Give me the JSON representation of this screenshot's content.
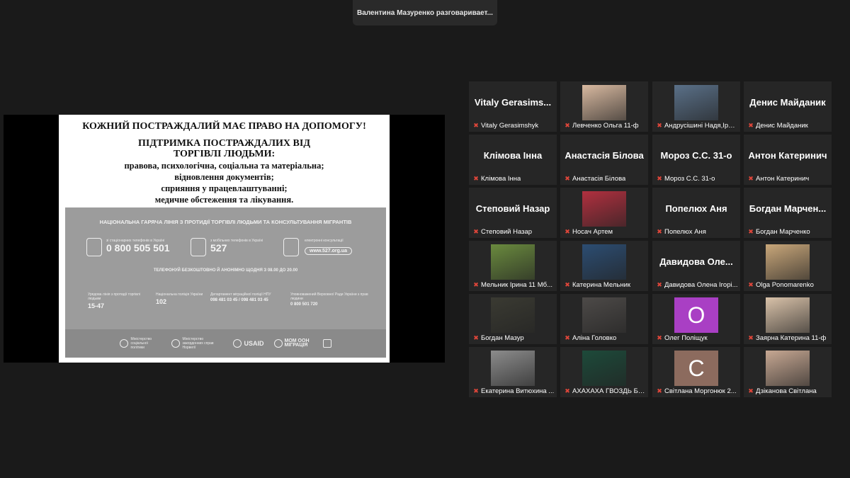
{
  "speaker_toast": "Валентина Мазуренко разговаривает...",
  "slide": {
    "heading_lines": [
      "КОЖНИЙ ПОСТРАЖДАЛИЙ МАЄ ПРАВО НА ДОПОМОГУ!",
      "ПІДТРИМКА ПОСТРАЖДАЛИХ ВІД",
      "ТОРГІВЛІ ЛЮДЬМИ:"
    ],
    "lines": [
      "правова, психологічна, соціальна та матеріальна;",
      "відновлення документів;",
      "сприяння у працевлаштуванні;",
      "медичне обстеження та лікування."
    ],
    "poster": {
      "title": "НАЦІОНАЛЬНА ГАРЯЧА ЛІНІЯ З ПРОТИДІЇ ТОРГІВЛІ ЛЮДЬМИ ТА КОНСУЛЬТУВАННЯ МІГРАНТІВ",
      "landline_caption": "зі стаціонарних телефонів в Україні",
      "landline_number": "0 800 505 501",
      "mobile_caption": "з мобільних телефонів в Україні",
      "mobile_number": "527",
      "online_caption": "електронні консультації",
      "online_url": "www.527.org.ua",
      "free_note": "ТЕЛЕФОНУЙ БЕЗКОШТОВНО Й АНОНІМНО ЩОДНЯ З 08.00 ДО 20.00",
      "contacts": [
        {
          "caption": "Урядова лінія з протидії торгівлі людьми",
          "number": "15-47"
        },
        {
          "caption": "Національна поліція України",
          "number": "102"
        },
        {
          "caption": "Департамент міграційної поліції НПУ",
          "number": "098 481 03 45  /  098 481 03 45"
        },
        {
          "caption": "Уповноважений Верховної Ради України з прав людини",
          "number": "0 800 501 720"
        }
      ],
      "logos": [
        {
          "name": "Міністерство соціальної політики"
        },
        {
          "name": "Міністерство закордонних справ Норвегії"
        },
        {
          "name": "USAID"
        },
        {
          "name": "МОМ ООН МІГРАЦІЯ"
        }
      ]
    }
  },
  "participants": [
    {
      "tile_name": "Vitaly Gerasims...",
      "label": "Vitaly Gerasimshyk",
      "photo": false
    },
    {
      "tile_name": "",
      "label": "Левченко Ольга 11-ф",
      "photo": true,
      "photo_color": "#d8b9a0"
    },
    {
      "tile_name": "",
      "label": "Андрусішині Надя,Іра,...",
      "photo": true,
      "photo_color": "#5a7088"
    },
    {
      "tile_name": "Денис Майданик",
      "label": "Денис Майданик",
      "photo": false
    },
    {
      "tile_name": "Клімова Інна",
      "label": "Клімова Інна",
      "photo": false
    },
    {
      "tile_name": "Анастасія Білова",
      "label": "Анастасія Білова",
      "photo": false
    },
    {
      "tile_name": "Мороз С.С. 31-о",
      "label": "Мороз С.С. 31-о",
      "photo": false
    },
    {
      "tile_name": "Антон Катеринич",
      "label": "Антон Катеринич",
      "photo": false
    },
    {
      "tile_name": "Степовий Назар",
      "label": "Степовий Назар",
      "photo": false
    },
    {
      "tile_name": "",
      "label": "Носач Артем",
      "photo": true,
      "photo_color": "#b1303f"
    },
    {
      "tile_name": "Попелюх Аня",
      "label": "Попелюх Аня",
      "photo": false
    },
    {
      "tile_name": "Богдан Марчен...",
      "label": "Богдан Марченко",
      "photo": false
    },
    {
      "tile_name": "",
      "label": "Мельник Ірина 11 Мб...",
      "photo": true,
      "photo_color": "#6a8a3e"
    },
    {
      "tile_name": "",
      "label": "Катерина Мельник",
      "photo": true,
      "photo_color": "#2c4d72"
    },
    {
      "tile_name": "Давидова Оле...",
      "label": "Давидова Олена Ігорі...",
      "photo": false
    },
    {
      "tile_name": "",
      "label": "Olga Ponomarenko",
      "photo": true,
      "photo_color": "#c9a77a"
    },
    {
      "tile_name": "",
      "label": "Богдан Мазур",
      "photo": true,
      "photo_color": "#3a3a32"
    },
    {
      "tile_name": "",
      "label": "Аліна Головко",
      "photo": true,
      "photo_color": "#4d4a48"
    },
    {
      "tile_name": "",
      "label": "Олег Поліщук",
      "photo": false,
      "avatar_letter": "O",
      "avatar_color": "#a93fc4"
    },
    {
      "tile_name": "",
      "label": "Заярна Катерина 11-ф",
      "photo": true,
      "photo_color": "#d9c2a9"
    },
    {
      "tile_name": "",
      "label": "Екатерина Витюхина ...",
      "photo": true,
      "photo_color": "#8c8c8c"
    },
    {
      "tile_name": "",
      "label": "АХАХАХА ГВОЗДЬ БЕГ...",
      "photo": true,
      "photo_color": "#1d4a3a"
    },
    {
      "tile_name": "",
      "label": "Світлана Моргонюк 2...",
      "photo": false,
      "avatar_letter": "C",
      "avatar_color": "#8c6b5e"
    },
    {
      "tile_name": "",
      "label": "Дзіканова Світлана",
      "photo": true,
      "photo_color": "#c7a893"
    }
  ],
  "icons": {
    "muted_mic": "mic-off-icon"
  }
}
